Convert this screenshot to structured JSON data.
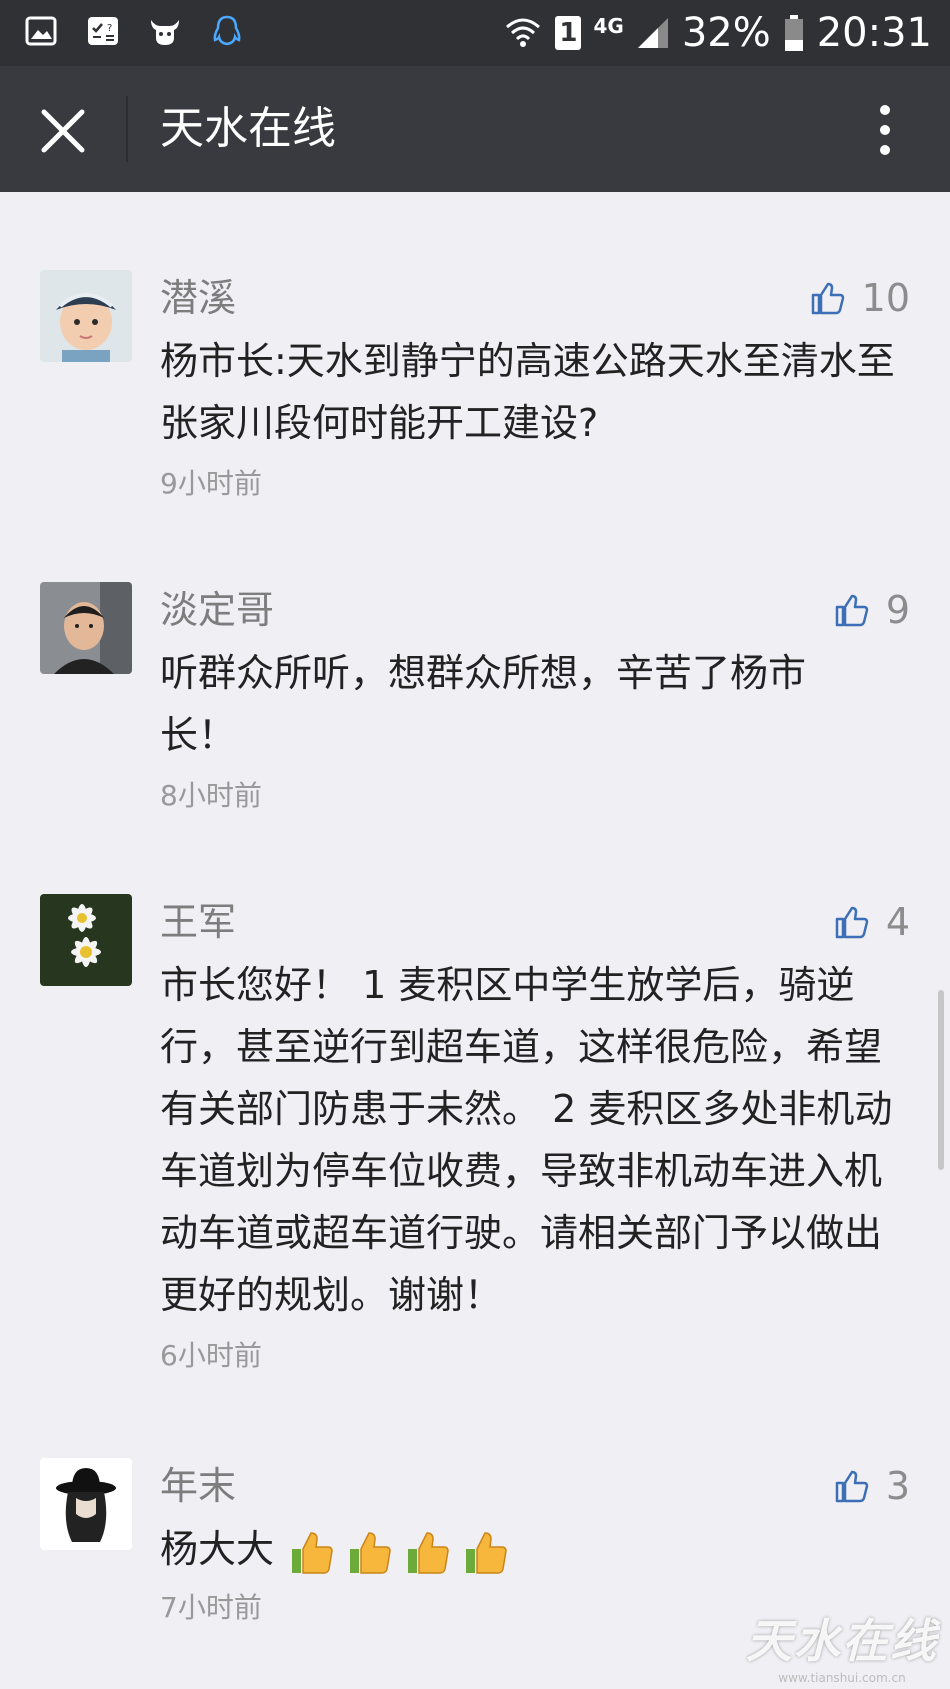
{
  "status_bar": {
    "battery": "32%",
    "time": "20:31",
    "network": "4G",
    "sim": "1",
    "left_icons": [
      "gallery-icon",
      "calculator-icon",
      "cow-app-icon",
      "qq-penguin-icon"
    ]
  },
  "title_bar": {
    "title": "天水在线",
    "close_icon": "close-icon",
    "menu_icon": "more-vertical-icon"
  },
  "comments": [
    {
      "nickname": "潜溪",
      "likes": "10",
      "content": "杨市长:天水到静宁的高速公路天水至清水至张家川段何时能开工建设?",
      "time": "9小时前",
      "avatar": "child-avatar"
    },
    {
      "nickname": "淡定哥",
      "likes": "9",
      "content": "听群众所听，想群众所想，辛苦了杨市长！",
      "time": "8小时前",
      "avatar": "man-avatar"
    },
    {
      "nickname": "王军",
      "likes": "4",
      "content": "市长您好！ 1  麦积区中学生放学后，骑逆行，甚至逆行到超车道，这样很危险，希望有关部门防患于未然。 2  麦积区多处非机动车道划为停车位收费，导致非机动车进入机动车道或超车道行驶。请相关部门予以做出更好的规划。谢谢！",
      "time": "6小时前",
      "avatar": "daisy-avatar"
    },
    {
      "nickname": "年末",
      "likes": "3",
      "content": "杨大大",
      "time": "7小时前",
      "avatar": "hat-avatar",
      "emojis": [
        "thumbs-up-emoji",
        "thumbs-up-emoji",
        "thumbs-up-emoji",
        "thumbs-up-emoji"
      ]
    }
  ],
  "watermark": {
    "logo": "天水在线",
    "url": "www.tianshui.com.cn"
  },
  "colors": {
    "status_bar": "#2f3135",
    "title_bar": "#393a3f",
    "background": "#efeff4",
    "like_icon": "#3d6fb6"
  }
}
